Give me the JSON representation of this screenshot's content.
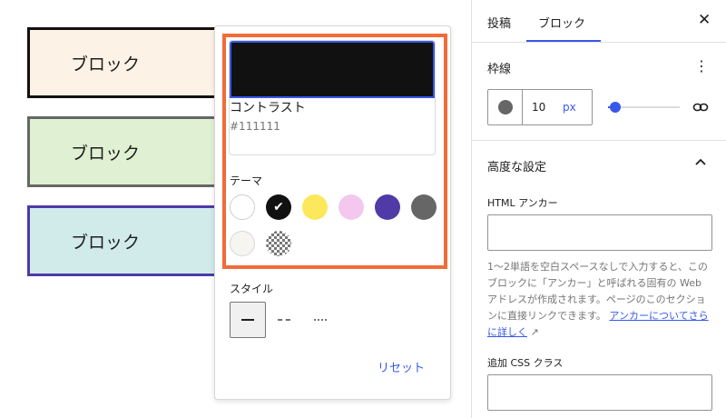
{
  "canvas": {
    "blocks": [
      {
        "label": "ブロック",
        "background": "#fdf2e6",
        "border": "#111111"
      },
      {
        "label": "ブロック",
        "background": "#e0f0d2",
        "border": "#666666"
      },
      {
        "label": "ブロック",
        "background": "#d1ebea",
        "border": "#4f3aa7"
      }
    ]
  },
  "popover": {
    "selected_color_name": "コントラスト",
    "selected_color_hex": "#111111",
    "theme_label": "テーマ",
    "swatches": [
      {
        "name": "white",
        "color": "#ffffff"
      },
      {
        "name": "contrast",
        "color": "#111111",
        "selected": true
      },
      {
        "name": "yellow",
        "color": "#fbe85b"
      },
      {
        "name": "pink",
        "color": "#f4c8ee"
      },
      {
        "name": "purple",
        "color": "#4f3aa7"
      },
      {
        "name": "gray",
        "color": "#666666"
      },
      {
        "name": "off-white",
        "color": "#f6f5ef"
      },
      {
        "name": "transparent",
        "color": "checker"
      }
    ],
    "style_label": "スタイル",
    "reset_label": "リセット"
  },
  "sidebar": {
    "tabs": [
      {
        "label": "投稿"
      },
      {
        "label": "ブロック",
        "active": true
      }
    ],
    "border": {
      "title": "枠線",
      "width_value": "10",
      "unit": "px",
      "slider_fraction": 0.1
    },
    "advanced": {
      "title": "高度な設定",
      "anchor_label": "HTML アンカー",
      "help_text": "1〜2単語を空白スペースなしで入力すると、このブロックに「アンカー」と呼ばれる固有の Web アドレスが作成されます。ページのこのセクションに直接リンクできます。",
      "help_link": "アンカーについてさらに詳しく",
      "css_label": "追加 CSS クラス"
    }
  }
}
